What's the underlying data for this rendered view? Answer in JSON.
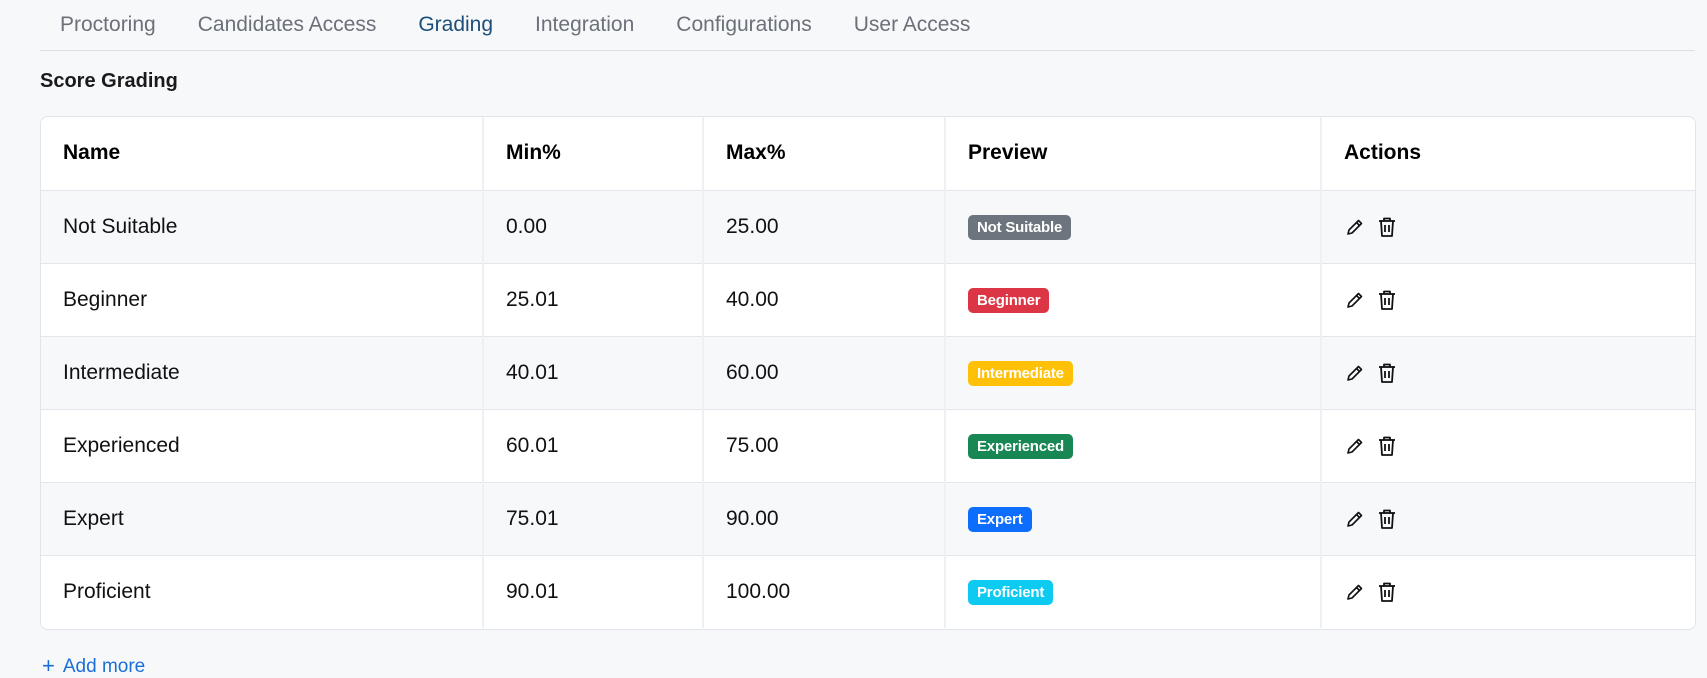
{
  "tabs": [
    {
      "label": "Proctoring",
      "active": false
    },
    {
      "label": "Candidates Access",
      "active": false
    },
    {
      "label": "Grading",
      "active": true
    },
    {
      "label": "Integration",
      "active": false
    },
    {
      "label": "Configurations",
      "active": false
    },
    {
      "label": "User Access",
      "active": false
    }
  ],
  "section": {
    "title": "Score Grading"
  },
  "table": {
    "headers": {
      "name": "Name",
      "min": "Min%",
      "max": "Max%",
      "preview": "Preview",
      "actions": "Actions"
    },
    "rows": [
      {
        "name": "Not Suitable",
        "min": "0.00",
        "max": "25.00",
        "badge": "Not Suitable",
        "color": "#6c757d"
      },
      {
        "name": "Beginner",
        "min": "25.01",
        "max": "40.00",
        "badge": "Beginner",
        "color": "#dc3545"
      },
      {
        "name": "Intermediate",
        "min": "40.01",
        "max": "60.00",
        "badge": "Intermediate",
        "color": "#ffc107"
      },
      {
        "name": "Experienced",
        "min": "60.01",
        "max": "75.00",
        "badge": "Experienced",
        "color": "#198754"
      },
      {
        "name": "Expert",
        "min": "75.01",
        "max": "90.00",
        "badge": "Expert",
        "color": "#0d6efd"
      },
      {
        "name": "Proficient",
        "min": "90.01",
        "max": "100.00",
        "badge": "Proficient",
        "color": "#0dcaf0"
      }
    ],
    "row_actions": [
      "pencil-icon",
      "trash-icon"
    ]
  },
  "add_more": {
    "label": "Add more",
    "icon": "plus-icon"
  },
  "colors": {
    "accent": "#1a6fd6",
    "active_tab": "#1d4e7a"
  }
}
